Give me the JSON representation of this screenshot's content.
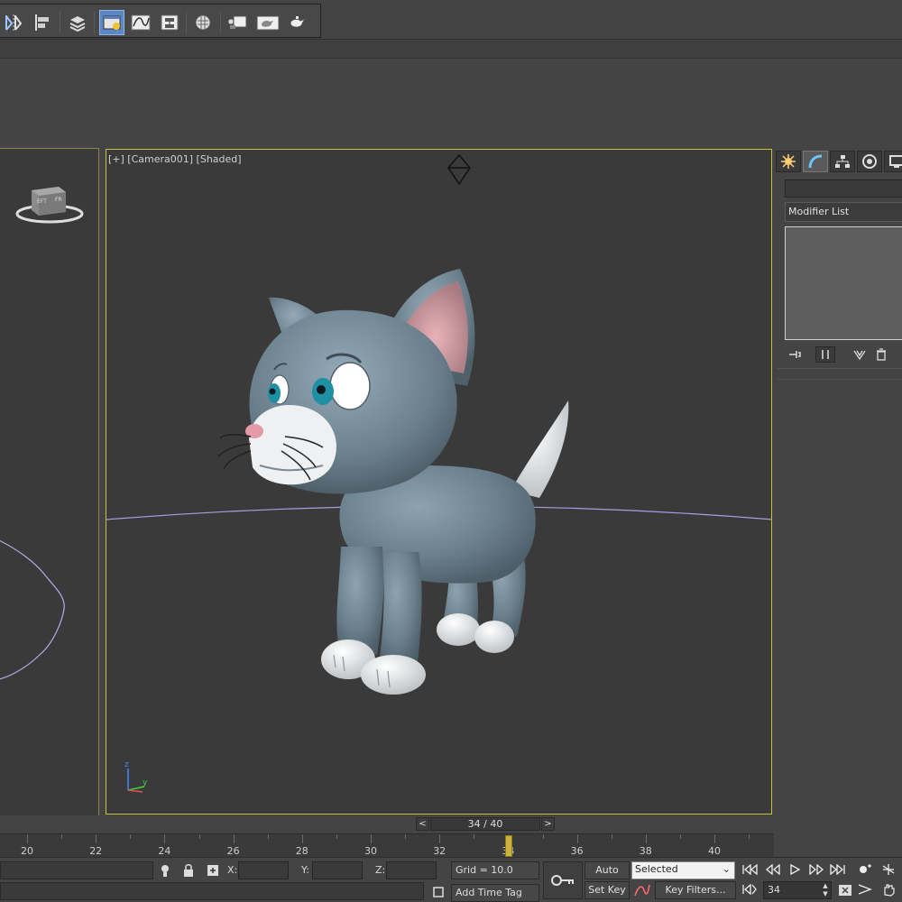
{
  "toolbar": {
    "buttons": [
      {
        "name": "mirror-icon"
      },
      {
        "name": "align-icon"
      },
      {
        "name": "layer-manager-icon"
      },
      {
        "name": "scene-explorer-icon"
      },
      {
        "name": "curve-editor-icon"
      },
      {
        "name": "schematic-view-icon"
      },
      {
        "name": "material-editor-icon"
      },
      {
        "name": "render-setup-icon"
      },
      {
        "name": "rendered-frame-window-icon"
      },
      {
        "name": "render-production-icon"
      }
    ],
    "active_button": "scene-explorer-icon",
    "accent_color": "#5c86c4"
  },
  "viewport": {
    "label": "[+] [Camera001] [Shaded]",
    "border_color": "#c9c038"
  },
  "command_panel": {
    "tabs": [
      "create-icon",
      "modify-icon",
      "hierarchy-icon",
      "motion-icon",
      "display-icon"
    ],
    "selected_tab": "modify-icon",
    "name_field": "",
    "modifier_list_label": "Modifier List"
  },
  "timeline": {
    "prev_label": "<",
    "next_label": ">",
    "frame_display": "34 / 40",
    "tick_labels": [
      "20",
      "22",
      "24",
      "26",
      "28",
      "30",
      "32",
      "34",
      "36",
      "38",
      "40"
    ],
    "current_frame": 34
  },
  "status": {
    "x_label": "X:",
    "y_label": "Y:",
    "z_label": "Z:",
    "x_value": "",
    "y_value": "",
    "z_value": "",
    "grid": "Grid = 10.0",
    "add_time_tag": "Add Time Tag",
    "auto_key": "Auto Key",
    "set_key": "Set Key",
    "key_filters": "Key Filters...",
    "selected_option": "Selected",
    "frame_value": "34"
  }
}
